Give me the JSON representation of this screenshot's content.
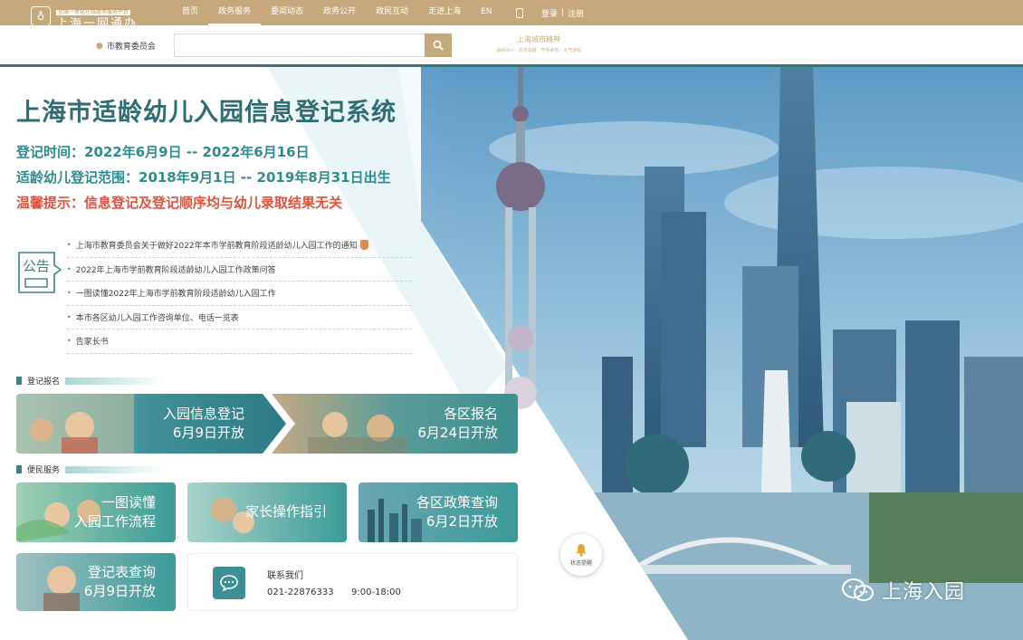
{
  "topnav": {
    "logo_sub": "全国一体化在线政务服务平台",
    "logo_main": "上海一网通办",
    "items": [
      "首页",
      "政务服务",
      "要闻动态",
      "政务公开",
      "政民互动",
      "走进上海",
      "EN"
    ],
    "active_index": 1,
    "login": "登录",
    "separator": "|",
    "register": "注册"
  },
  "search": {
    "location": "市教育委员会",
    "placeholder": "",
    "brand_title": "上海城市精神",
    "brand_sub": "海纳百川 · 追求卓越 · 开明睿智 · 大气谦和"
  },
  "hero": {
    "title": "上海市适龄幼儿入园信息登记系统",
    "registration_time": "登记时间：2022年6月9日 -- 2022年6月16日",
    "age_range": "适龄幼儿登记范围：2018年9月1日 -- 2019年8月31日出生",
    "tip": "温馨提示：信息登记及登记顺序均与幼儿录取结果无关"
  },
  "notice": {
    "label": "公告",
    "items": [
      "上海市教育委员会关于做好2022年本市学前教育阶段适龄幼儿入园工作的通知",
      "2022年上海市学前教育阶段适龄幼儿入园工作政策问答",
      "一图读懂2022年上海市学前教育阶段适龄幼儿入园工作",
      "本市各区幼儿入园工作咨询单位、电话一览表",
      "告家长书"
    ]
  },
  "sections": {
    "register": "登记报名",
    "service": "便民服务"
  },
  "cards": {
    "register_info": {
      "line1": "入园信息登记",
      "line2": "6月9日开放"
    },
    "district_signup": {
      "line1": "各区报名",
      "line2": "6月24日开放"
    },
    "one_chart": {
      "line1": "一图读懂",
      "line2": "入园工作流程"
    },
    "parent_guide": {
      "line1": "家长操作指引"
    },
    "district_policy": {
      "line1": "各区政策查询",
      "line2": "6月2日开放"
    },
    "form_query": {
      "line1": "登记表查询",
      "line2": "6月9日开放"
    }
  },
  "contact": {
    "title": "联系我们",
    "phone": "021-22876333",
    "hours": "9:00-18:00"
  },
  "status_button": {
    "label": "状态提醒"
  },
  "watermark": {
    "text": "上海入园"
  },
  "colors": {
    "nav_gold": "#c5a97a",
    "teal_title": "#2e6e72",
    "teal_info": "#2e8c8f",
    "warning_red": "#e2513a",
    "card_teal": "#3b8f95"
  }
}
